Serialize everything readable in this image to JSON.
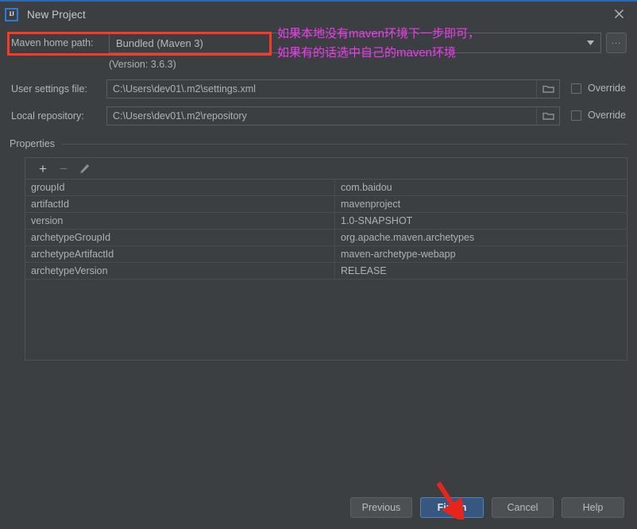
{
  "window": {
    "title": "New Project",
    "app_icon": "intellij-idea-icon",
    "close_icon": "close-icon",
    "accent_border": "#2d6ab5"
  },
  "maven_home": {
    "label": "Maven home path:",
    "value": "Bundled (Maven 3)",
    "dropdown_icon": "chevron-down-icon",
    "browse_label": "...",
    "version_note": "(Version: 3.6.3)"
  },
  "user_settings": {
    "label": "User settings file:",
    "value": "C:\\Users\\dev01\\.m2\\settings.xml",
    "folder_icon": "folder-icon",
    "override_label": "Override",
    "override_checked": false
  },
  "local_repository": {
    "label": "Local repository:",
    "value": "C:\\Users\\dev01\\.m2\\repository",
    "folder_icon": "folder-icon",
    "override_label": "Override",
    "override_checked": false
  },
  "properties": {
    "section_label": "Properties",
    "toolbar": {
      "add_label": "+",
      "remove_label": "−",
      "edit_icon": "pencil-icon"
    },
    "rows": [
      {
        "key": "groupId",
        "value": "com.baidou"
      },
      {
        "key": "artifactId",
        "value": "mavenproject"
      },
      {
        "key": "version",
        "value": "1.0-SNAPSHOT"
      },
      {
        "key": "archetypeGroupId",
        "value": "org.apache.maven.archetypes"
      },
      {
        "key": "archetypeArtifactId",
        "value": "maven-archetype-webapp"
      },
      {
        "key": "archetypeVersion",
        "value": "RELEASE"
      }
    ]
  },
  "footer": {
    "previous": "Previous",
    "finish": "Finish",
    "cancel": "Cancel",
    "help": "Help",
    "primary_color": "#365880"
  },
  "annotations": {
    "highlight_color": "#f93a28",
    "note_color": "#ef3aef",
    "note_text": "如果本地没有maven环境下一步即可，\n如果有的话选中自己的maven环境",
    "arrow_target": "finish-button"
  }
}
